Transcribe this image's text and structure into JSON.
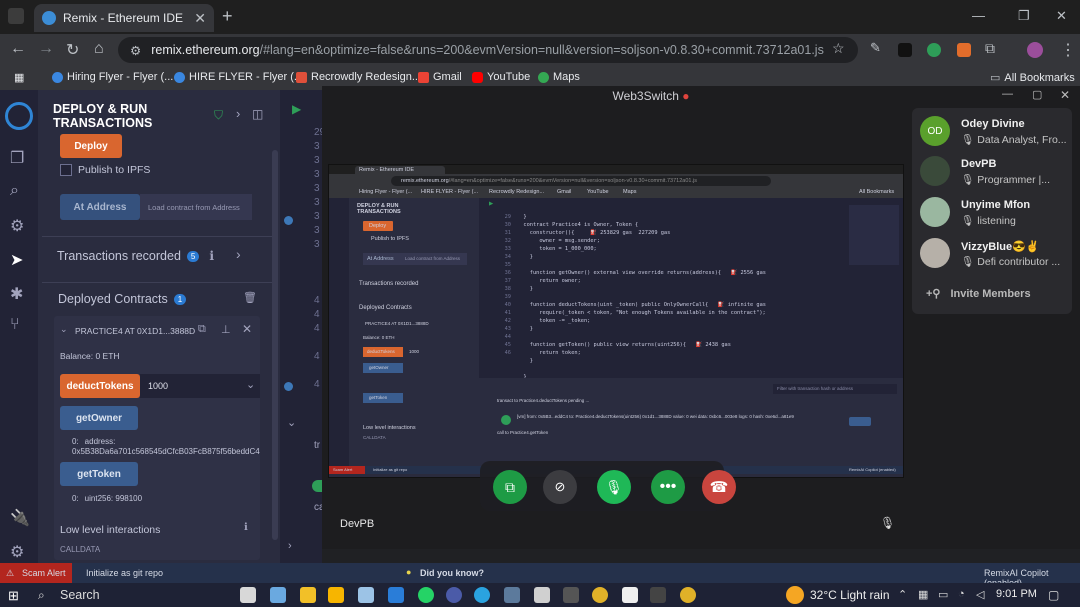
{
  "browser": {
    "tab_title": "Remix - Ethereum IDE",
    "url_host": "remix.ethereum.org",
    "url_path": "/#lang=en&optimize=false&runs=200&evmVersion=null&version=soljson-v0.8.30+commit.73712a01.js",
    "bookmarks": [
      "Hiring Flyer - Flyer (...",
      "HIRE FLYER - Flyer (...",
      "Recrowdly Redesign...",
      "Gmail",
      "YouTube",
      "Maps"
    ],
    "all_bookmarks": "All Bookmarks"
  },
  "remix": {
    "panel_title": "DEPLOY & RUN TRANSACTIONS",
    "deploy_label": "Deploy",
    "publish_ipfs": "Publish to IPFS",
    "at_address_label": "At Address",
    "load_contract_label": "Load contract from Address",
    "transactions_recorded": "Transactions recorded",
    "transactions_count": "5",
    "deployed_contracts": "Deployed Contracts",
    "deployed_count": "1",
    "contract_name": "PRACTICE4 AT 0X1D1...3888D",
    "balance": "Balance: 0 ETH",
    "deduct_label": "deductTokens",
    "deduct_value": "1000",
    "get_owner_label": "getOwner",
    "owner_result_key": "0:",
    "owner_result": "address: 0x5B38Da6a701c568545dCfcB03FcB875f56beddC4",
    "get_token_label": "getToken",
    "token_result_key": "0:",
    "token_result": "uint256: 998100",
    "low_level": "Low level interactions",
    "calldata": "CALLDATA",
    "line_numbers": [
      "29",
      "3",
      "3",
      "3",
      "3",
      "3",
      "3",
      "3",
      "3",
      "4",
      "4",
      "4",
      "4",
      "4"
    ],
    "status": {
      "scam_alert": "Scam Alert",
      "git": "Initialize as git repo",
      "did_you_know": "Did you know?",
      "copilot": "RemixAI Copilot (enabled)"
    }
  },
  "call": {
    "window_title": "Web3Switch",
    "presenter_name": "DevPB",
    "participants": [
      {
        "name": "Odey Divine",
        "role": "Data Analyst, Fro...",
        "initials": "OD",
        "color": "#5aa02c"
      },
      {
        "name": "DevPB",
        "role": "Programmer |...",
        "initials": "",
        "color": "#3a4a3a"
      },
      {
        "name": "Unyime Mfon",
        "role": "listening",
        "initials": "",
        "color": "#9ab7a0"
      },
      {
        "name": "VizzyBlue😎✌",
        "role": "Defi contributor ...",
        "initials": "",
        "color": "#b6b0a8"
      }
    ],
    "invite_label": "Invite Members",
    "shared_code": [
      "  }",
      "  contract Practice4 is Owner, Token {",
      "    constructor(){     ⛽ 253829 gas  227209 gas",
      "       owner = msg.sender;",
      "       token = 1_000_000;",
      "    }",
      "",
      "    function getOwner() external view override returns(address){   ⛽ 2556 gas",
      "       return owner;",
      "    }",
      "",
      "    function deductTokens(uint _token) public OnlyOwnerCall{   ⛽ infinite gas",
      "       require(_token < token, \"Not enough Tokens available in the contract\");",
      "       token -= _token;",
      "    }",
      "",
      "    function getToken() public view returns(uint256){   ⛽ 2438 gas",
      "       return token;",
      "    }",
      "",
      "  }"
    ],
    "shared_line_numbers": [
      "29",
      "30",
      "31",
      "32",
      "33",
      "34",
      "35",
      "36",
      "37",
      "38",
      "39",
      "40",
      "41",
      "42",
      "43",
      "44",
      "45",
      "46"
    ],
    "terminal_line1": "transact to Practice4.deductTokens pending ...",
    "terminal_line2": "[vm] from: 0x5B3...eddC4 to: Practice4.deductTokens(uint256) 0x1d1...3888D value: 0 wei data: 0xbc6...003e8 logs: 0 hash: 0xe6d...a81e9",
    "terminal_line3": "call to Practice4.getToken",
    "terminal_search": "Filter with transaction hash or address"
  },
  "taskbar": {
    "search": "Search",
    "weather": "32°C  Light rain",
    "time": "9:01 PM"
  }
}
